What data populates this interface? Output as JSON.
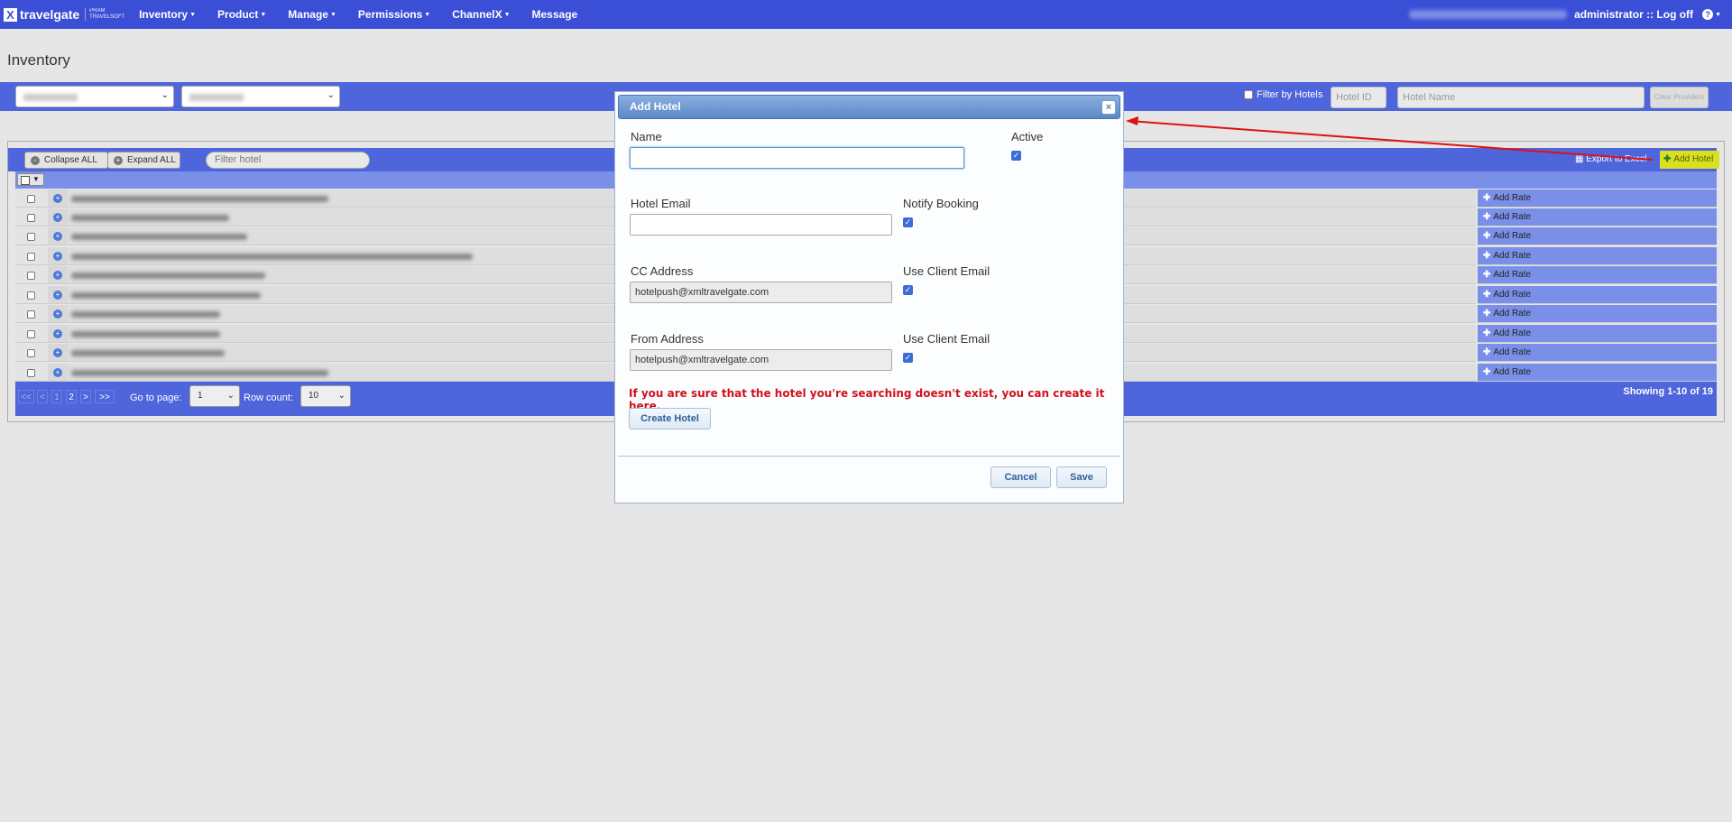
{
  "nav": {
    "brand": "travelgate",
    "brand_sub_1": "PRAM",
    "brand_sub_2": "TRAVELSOFT",
    "items": [
      "Inventory",
      "Product",
      "Manage",
      "Permissions",
      "ChannelX",
      "Message"
    ],
    "user": "administrator :: Log off",
    "help_icon": "question-icon"
  },
  "page": {
    "title": "Inventory"
  },
  "filters": {
    "filter_by_label": "Filter by Hotels",
    "hotel_id_placeholder": "Hotel ID",
    "hotel_name_placeholder": "Hotel Name",
    "clear_label": "Clear Providers"
  },
  "toolbar": {
    "collapse_all": "Collapse ALL",
    "expand_all": "Expand ALL",
    "filter_placeholder": "Filter hotel",
    "export_label": "Export to Excel",
    "add_hotel_label": "Add Hotel"
  },
  "rows": [
    {
      "action": "Add Rate"
    },
    {
      "action": "Add Rate"
    },
    {
      "action": "Add Rate"
    },
    {
      "action": "Add Rate"
    },
    {
      "action": "Add Rate"
    },
    {
      "action": "Add Rate"
    },
    {
      "action": "Add Rate"
    },
    {
      "action": "Add Rate"
    },
    {
      "action": "Add Rate"
    },
    {
      "action": "Add Rate"
    }
  ],
  "pager": {
    "first": "<<",
    "prev": "<",
    "page1": "1",
    "page2": "2",
    "next": ">",
    "last": ">>",
    "goto_label": "Go to page:",
    "goto_value": "1",
    "rowcount_label": "Row count:",
    "rowcount_value": "10",
    "showing": "Showing 1-10 of 19"
  },
  "modal": {
    "title": "Add Hotel",
    "name_label": "Name",
    "name_value": "",
    "active_label": "Active",
    "active_checked": true,
    "email_label": "Hotel Email",
    "email_value": "",
    "notify_label": "Notify Booking",
    "notify_checked": true,
    "cc_label": "CC Address",
    "cc_value": "hotelpush@xmltravelgate.com",
    "use_client_email_label": "Use Client Email",
    "from_label": "From Address",
    "from_value": "hotelpush@xmltravelgate.com",
    "use_client_email_label_2": "Use Client Email",
    "warning": "If you are sure that the hotel you're searching doesn't exist, you can create it here.",
    "create_hotel": "Create Hotel",
    "cancel": "Cancel",
    "save": "Save"
  },
  "colors": {
    "navbar": "#3a4fd6",
    "bar": "#4e65db",
    "accent_highlight": "#d9e021",
    "warning": "#d0121c",
    "annotation_arrow": "#e01010"
  }
}
